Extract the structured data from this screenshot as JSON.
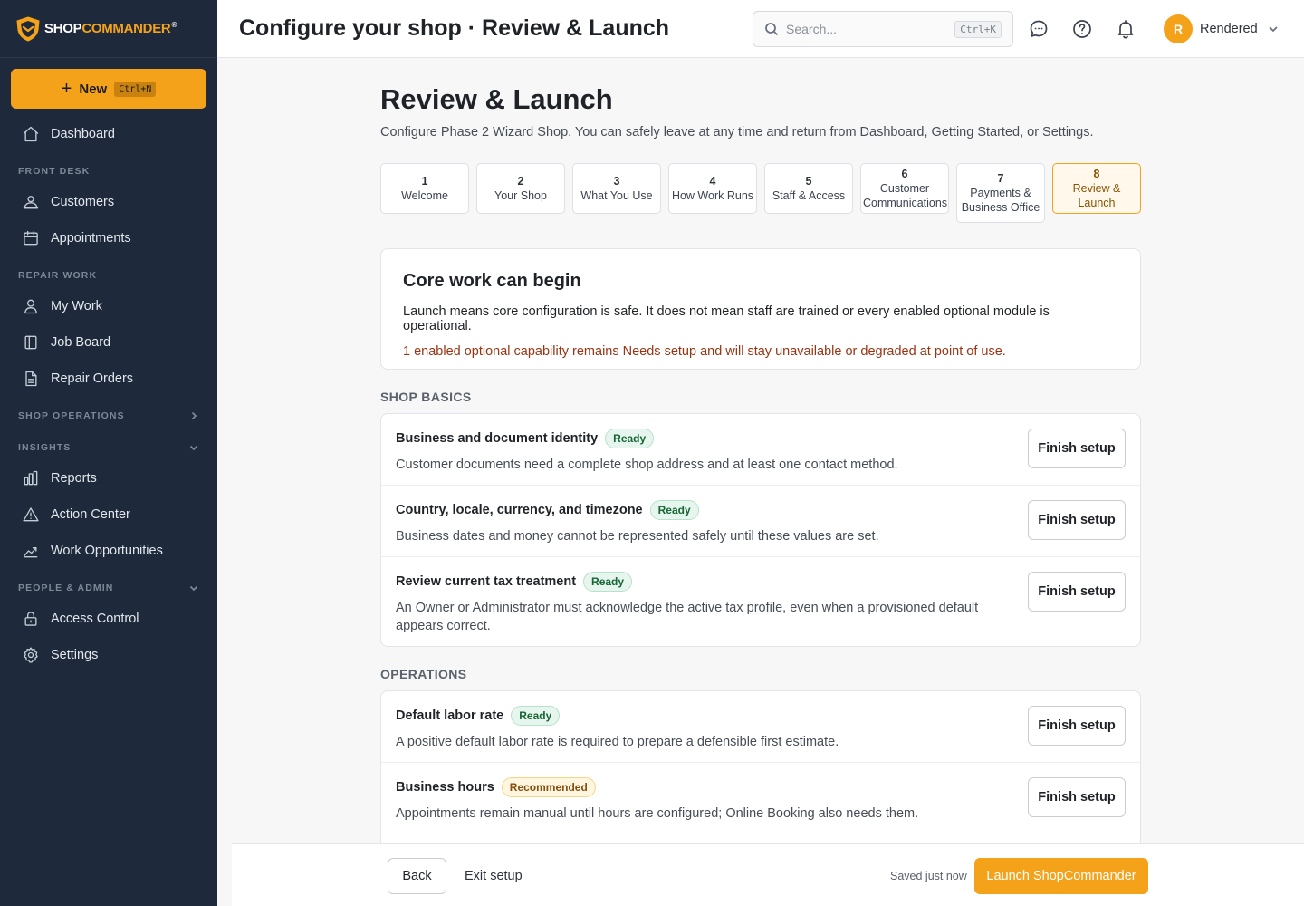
{
  "brand": {
    "shop": "SHOP",
    "commander": "COMMANDER",
    "reg": "®"
  },
  "sidebar": {
    "new_label": "New",
    "new_shortcut": "Ctrl+N",
    "dashboard": "Dashboard",
    "sections": {
      "front_desk": "FRONT DESK",
      "repair_work": "REPAIR WORK",
      "shop_operations": "SHOP OPERATIONS",
      "insights": "INSIGHTS",
      "people_admin": "PEOPLE & ADMIN"
    },
    "items": {
      "customers": "Customers",
      "appointments": "Appointments",
      "my_work": "My Work",
      "job_board": "Job Board",
      "repair_orders": "Repair Orders",
      "reports": "Reports",
      "action_center": "Action Center",
      "work_opportunities": "Work Opportunities",
      "access_control": "Access Control",
      "settings": "Settings"
    }
  },
  "header": {
    "title": "Configure your shop · Review & Launch",
    "search_placeholder": "Search...",
    "search_shortcut": "Ctrl+K",
    "user_initial": "R",
    "user_name": "Rendered"
  },
  "main": {
    "title": "Review & Launch",
    "subtitle": "Configure Phase 2 Wizard Shop. You can safely leave at any time and return from Dashboard, Getting Started, or Settings.",
    "steps": [
      {
        "num": "1",
        "label": "Welcome"
      },
      {
        "num": "2",
        "label": "Your Shop"
      },
      {
        "num": "3",
        "label": "What You Use"
      },
      {
        "num": "4",
        "label": "How Work Runs"
      },
      {
        "num": "5",
        "label": "Staff & Access"
      },
      {
        "num": "6",
        "label": "Customer Communications"
      },
      {
        "num": "7",
        "label": "Payments & Business Office"
      },
      {
        "num": "8",
        "label": "Review & Launch"
      }
    ],
    "core": {
      "title": "Core work can begin",
      "line": "Launch means core configuration is safe. It does not mean staff are trained or every enabled optional module is operational.",
      "warning": "1 enabled optional capability remains Needs setup and will stay unavailable or degraded at point of use."
    },
    "shop_basics": {
      "label": "SHOP BASICS",
      "rows": [
        {
          "title": "Business and document identity",
          "badge": "Ready",
          "desc": "Customer documents need a complete shop address and at least one contact method.",
          "button": "Finish setup"
        },
        {
          "title": "Country, locale, currency, and timezone",
          "badge": "Ready",
          "desc": "Business dates and money cannot be represented safely until these values are set.",
          "button": "Finish setup"
        },
        {
          "title": "Review current tax treatment",
          "badge": "Ready",
          "desc": "An Owner or Administrator must acknowledge the active tax profile, even when a provisioned default appears correct.",
          "button": "Finish setup"
        }
      ]
    },
    "operations": {
      "label": "OPERATIONS",
      "rows": [
        {
          "title": "Default labor rate",
          "badge": "Ready",
          "desc": "A positive default labor rate is required to prepare a defensible first estimate.",
          "button": "Finish setup"
        },
        {
          "title": "Business hours",
          "badge": "Recommended",
          "desc": "Appointments remain manual until hours are configured; Online Booking also needs them.",
          "button": "Finish setup"
        }
      ]
    }
  },
  "footer": {
    "back": "Back",
    "exit": "Exit setup",
    "saved": "Saved just now",
    "launch": "Launch ShopCommander"
  }
}
